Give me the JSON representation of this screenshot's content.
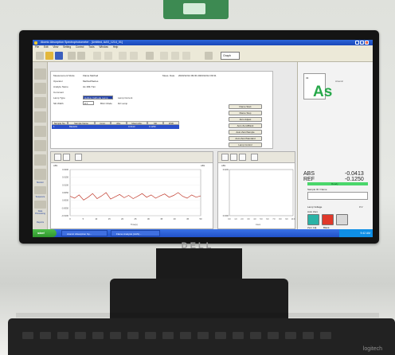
{
  "window": {
    "title": "Atomic Absorption Spectrophotometer - [Untitled, AAS_1214_01]",
    "menu": [
      "File",
      "Edit",
      "View",
      "Setting",
      "Control",
      "Tools",
      "Window",
      "Help"
    ],
    "toolbar_select": "Graph"
  },
  "sidebar": {
    "items": [
      "",
      "",
      "",
      "",
      "",
      "",
      "",
      "",
      "Monitor",
      "Sequence",
      "Data Processing",
      "Reports"
    ]
  },
  "parameters": {
    "rows": [
      {
        "label": "Measurement Mode",
        "value": "Flame Method"
      },
      {
        "label": "Operator",
        "value": "Method/Series"
      },
      {
        "label": "Analyte Name",
        "value": "As 193.7nm"
      },
      {
        "label": "Comment",
        "value": ""
      },
      {
        "label": "Lamp Type",
        "value": "Hollow Cathode Lamp"
      },
      {
        "label": "Slit Width",
        "value": "0.7"
      }
    ],
    "lamp_current_label": "Lamp Current",
    "d2_label": "D2 Lamp",
    "bgc_label": "BGC Mode",
    "meas_date_label": "Meas. Date",
    "meas_date_value": "2023/12/14 09:30  2023/12/14 09:31",
    "commands_title": "Instrument",
    "commands": [
      "Flame Start",
      "Flame Stop",
      "Zero Adjust",
      "Auto Zero/Blank",
      "Auto Zero/Sample",
      "Auto Zero/Standard",
      "Lamp Control",
      "Reset Data",
      "Manual Meas."
    ],
    "table_headers": [
      "Sample No.",
      "Sample Name",
      "Conc.",
      "Abs.",
      "Mean Abs.",
      "SD",
      "RSD"
    ],
    "table_selected": [
      "1",
      "Blank01",
      "",
      "",
      "0.0413",
      "0.1250",
      ""
    ]
  },
  "element": {
    "name": "Arsenic",
    "symbol": "As",
    "number": "33"
  },
  "readouts": {
    "abs_label": "ABS",
    "abs_value": "-0.0413",
    "ref_label": "REF",
    "ref_value": "-0.1250"
  },
  "status": {
    "ok": "Ready",
    "sample_id_label": "Sample ID / Name"
  },
  "right_controls": {
    "lamp_label": "Lamp Voltage",
    "lamp_value": "0 V",
    "auto_label": "Auto Zero",
    "btn1_label": "Zero Adj.",
    "btn2_label": "Blank"
  },
  "plot_left": {
    "title": "ABS",
    "ylabel": "ABS",
    "right_label": "ABS",
    "y_ticks": [
      "0.0200",
      "0.0150",
      "0.0100",
      "0.0050",
      "0.0000",
      "-0.0050",
      "-0.0100"
    ],
    "x_ticks": [
      "0",
      "5",
      "10",
      "15",
      "20",
      "25",
      "30",
      "35",
      "40",
      "45",
      "50"
    ],
    "xlabel": "Time(s)",
    "trace": [
      0.58,
      0.62,
      0.55,
      0.66,
      0.6,
      0.52,
      0.63,
      0.57,
      0.5,
      0.64,
      0.59,
      0.54,
      0.61,
      0.56,
      0.63,
      0.58,
      0.52,
      0.6,
      0.55,
      0.62,
      0.57,
      0.53,
      0.6,
      0.56,
      0.5,
      0.58,
      0.62,
      0.55,
      0.6,
      0.57
    ]
  },
  "plot_right": {
    "title": "ABS",
    "y_ticks": [
      "0.0200",
      "",
      "",
      "",
      "0.0000"
    ],
    "x_ticks": [
      "0.0",
      "1.0",
      "2.0",
      "3.0",
      "4.0",
      "5.0",
      "6.0",
      "7.0",
      "8.0",
      "9.0",
      "10.0"
    ],
    "xlabel": "Conc."
  },
  "taskbar": {
    "start": "start",
    "tasks": [
      "Atomic Absorption Sp...",
      "Flame Analysis (AAS)..."
    ],
    "clock": "9:42 AM"
  },
  "monitor": {
    "brand": "DELL"
  },
  "keyboard": {
    "brand": "logitech"
  },
  "colors": {
    "element_green": "#27a84a",
    "ok_green": "#4ad76b",
    "xp_blue": "#2151c7",
    "selection_blue": "#2a4fc9"
  }
}
